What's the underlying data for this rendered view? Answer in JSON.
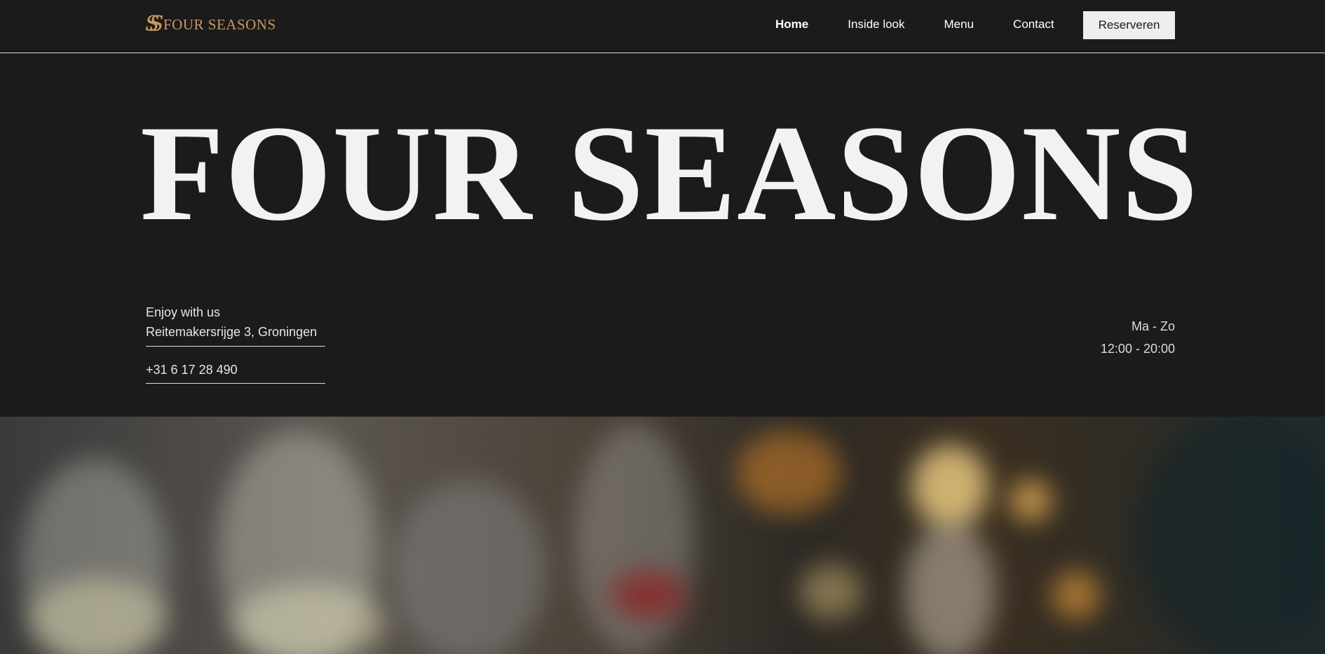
{
  "brand": {
    "mark": "SS",
    "name": "FOUR SEASONS",
    "color": "#c9995f"
  },
  "nav": {
    "items": [
      {
        "label": "Home",
        "active": true
      },
      {
        "label": "Inside look",
        "active": false
      },
      {
        "label": "Menu",
        "active": false
      },
      {
        "label": "Contact",
        "active": false
      }
    ],
    "cta_label": "Reserveren"
  },
  "hero": {
    "title": "FOUR SEASONS"
  },
  "info": {
    "tagline": "Enjoy with us",
    "address": "Reitemakersrijge 3, Groningen",
    "phone": "+31 6 17 28 490"
  },
  "hours": {
    "days": "Ma - Zo",
    "time": "12:00 - 20:00"
  },
  "colors": {
    "background": "#1b1b1b",
    "text": "#eeeeee",
    "button_bg": "#eeeeee"
  }
}
